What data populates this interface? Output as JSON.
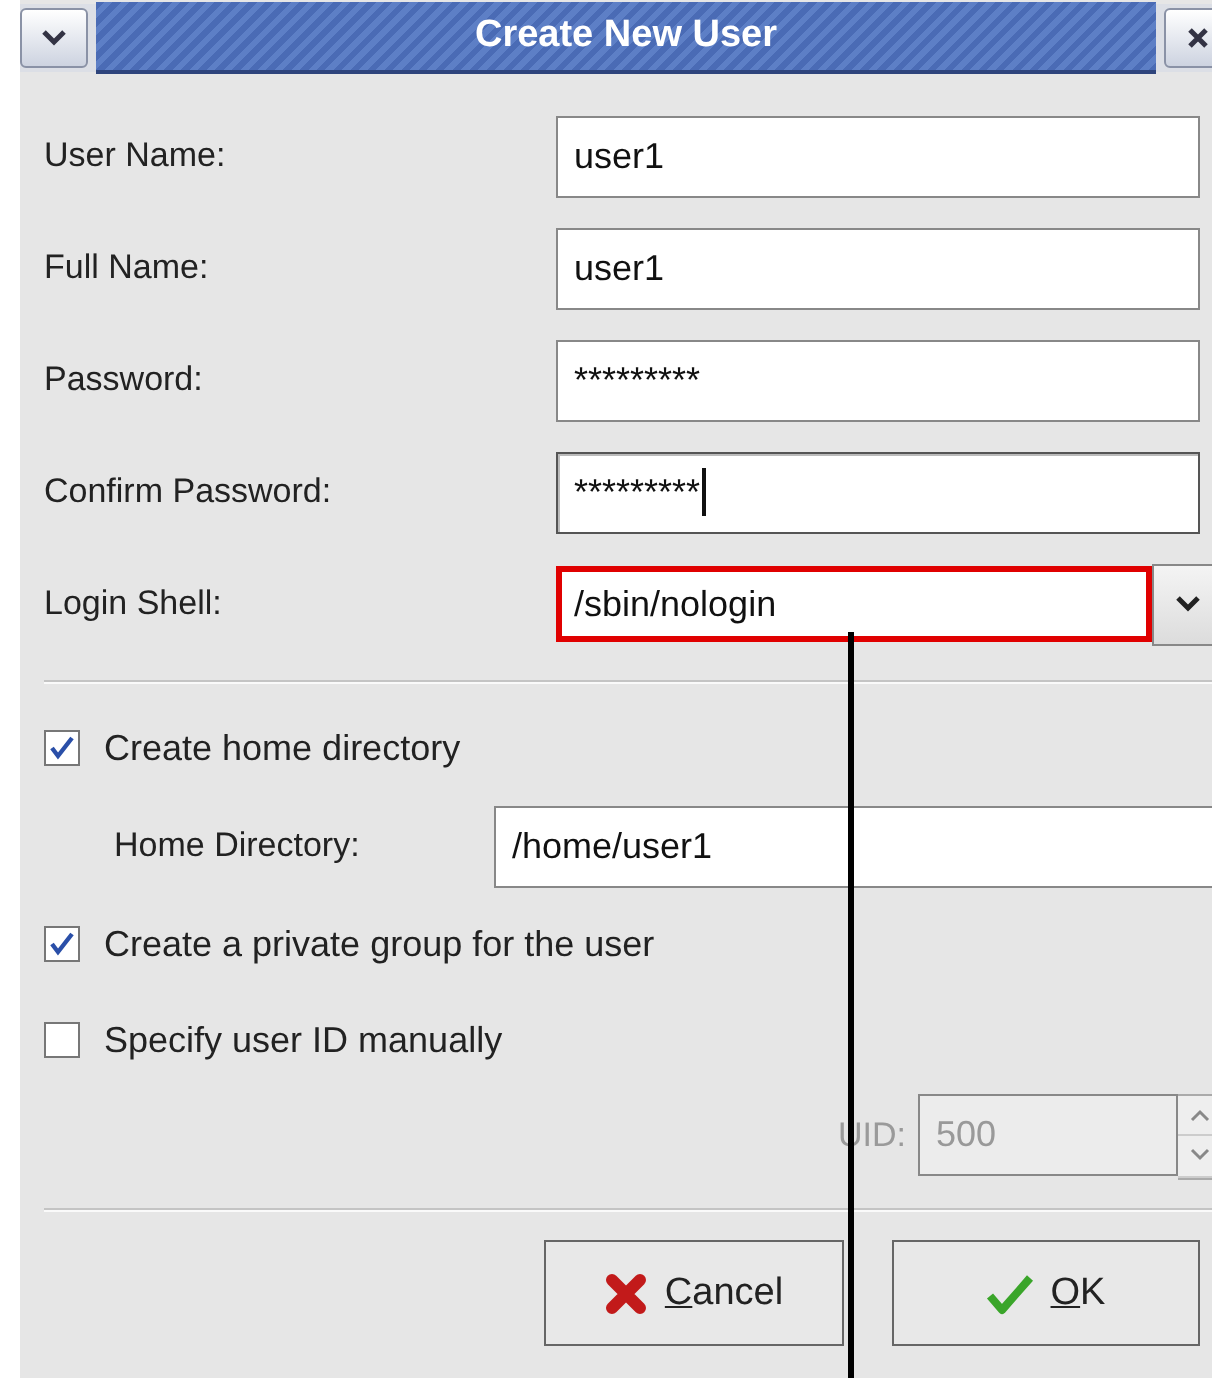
{
  "window": {
    "title": "Create New User"
  },
  "fields": [
    {
      "label": "User Name:",
      "value": "user1",
      "focused": false
    },
    {
      "label": "Full Name:",
      "value": "user1",
      "focused": false
    },
    {
      "label": "Password:",
      "value": "*********",
      "focused": false
    },
    {
      "label": "Confirm Password:",
      "value": "*********",
      "focused": true
    }
  ],
  "login_shell": {
    "label": "Login Shell:",
    "value": "/sbin/nologin",
    "highlighted": true
  },
  "create_home": {
    "label": "Create home directory",
    "checked": true
  },
  "home_directory": {
    "label": "Home Directory:",
    "value": "/home/user1"
  },
  "private_group": {
    "label": "Create a private group for the user",
    "checked": true
  },
  "specify_uid": {
    "label": "Specify user ID manually",
    "checked": false
  },
  "uid": {
    "label": "UID:",
    "value": "500",
    "disabled": true
  },
  "buttons": [
    {
      "kind": "cancel",
      "label": "Cancel"
    },
    {
      "kind": "ok",
      "label": "OK"
    }
  ]
}
